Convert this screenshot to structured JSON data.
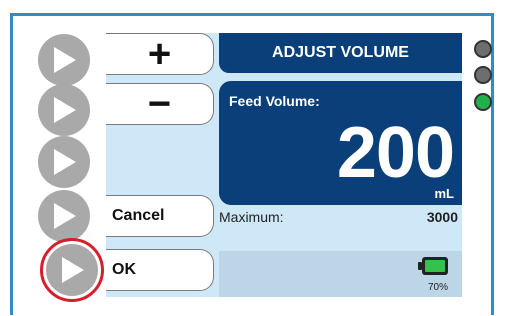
{
  "header": {
    "title": "ADJUST VOLUME"
  },
  "softkeys": {
    "plus_symbol": "+",
    "minus_symbol": "−",
    "cancel_label": "Cancel",
    "ok_label": "OK"
  },
  "volume": {
    "label": "Feed Volume:",
    "value": "200",
    "unit": "mL"
  },
  "maximum": {
    "label": "Maximum:",
    "value": "3000"
  },
  "battery": {
    "percent_text": "70%",
    "level": 0.7
  },
  "indicators": [
    {
      "name": "led-1",
      "state": "off"
    },
    {
      "name": "led-2",
      "state": "off"
    },
    {
      "name": "led-3",
      "state": "on",
      "color": "#22b04b"
    }
  ],
  "colors": {
    "frame": "#2f8bc9",
    "panel": "#0a3f79",
    "screen": "#cfe8f7",
    "highlight_ring": "#d71e2b"
  }
}
